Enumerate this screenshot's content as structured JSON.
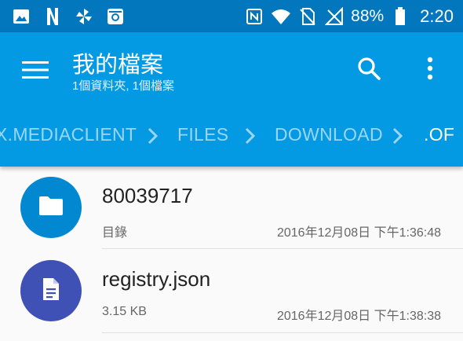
{
  "status_bar": {
    "left_icons": [
      "image-icon",
      "netflix-icon",
      "pinwheel-icon",
      "instagram-icon"
    ],
    "right_icons": [
      "nfc-icon",
      "wifi-icon",
      "no-sim-icon",
      "no-signal-icon",
      "battery-icon"
    ],
    "battery": "88%",
    "battery_level": 0.88,
    "time": "2:20"
  },
  "app_bar": {
    "title": "我的檔案",
    "subtitle": "1個資料夾, 1個檔案",
    "icons": [
      "menu-icon",
      "search-icon",
      "more-vert-icon"
    ]
  },
  "breadcrumb": {
    "items": [
      {
        "label": "X.MEDIACLIENT"
      },
      {
        "label": "FILES"
      },
      {
        "label": "DOWNLOAD"
      },
      {
        "label": ".OF"
      }
    ]
  },
  "files": [
    {
      "name": "80039717",
      "meta": "目錄",
      "date": "2016年12月08日 下午1:36:48",
      "icon": "folder-icon",
      "color": "#0288d1"
    },
    {
      "name": "registry.json",
      "meta": "3.15 KB",
      "date": "2016年12月08日 下午1:38:38",
      "icon": "document-icon",
      "color": "#3f51b5"
    }
  ],
  "colors": {
    "status_bar": "#0277bd",
    "app_bar": "#0399e3",
    "folder": "#0288d1",
    "document": "#3f51b5"
  }
}
